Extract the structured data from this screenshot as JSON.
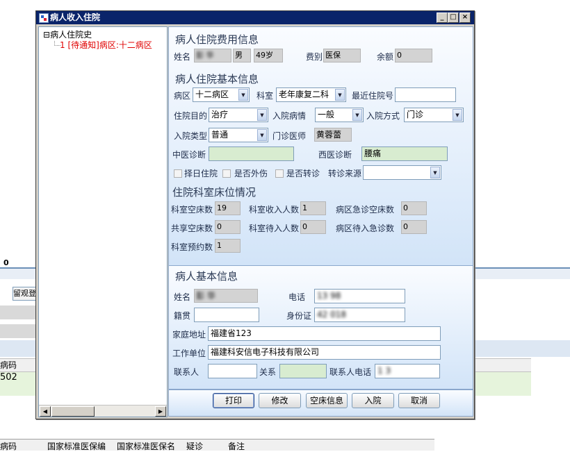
{
  "background": {
    "zero_label": "0",
    "button_label": "留观登",
    "table_header": "病码",
    "table_cell": "502",
    "footer_columns": [
      "病码",
      "国家标准医保编",
      "国家标准医保名",
      "疑诊",
      "备注"
    ]
  },
  "dialog": {
    "title": "病人收入住院",
    "window_buttons": {
      "minimize": "_",
      "maximize": "□",
      "close": "×"
    },
    "tree": {
      "root": "病人住院史",
      "child": "1 [待通知]病区:十二病区"
    },
    "fee_section": {
      "title": "病人住院费用信息",
      "name_label": "姓名",
      "name_value": "彭  华",
      "gender_value": "男",
      "age_value": "49岁",
      "fee_type_label": "费别",
      "fee_type_value": "医保",
      "balance_label": "余额",
      "balance_value": "0"
    },
    "basic_section": {
      "title": "病人住院基本信息",
      "ward_label": "病区",
      "ward_value": "十二病区",
      "dept_label": "科室",
      "dept_value": "老年康复二科",
      "recent_no_label": "最近住院号",
      "recent_no_value": "",
      "purpose_label": "住院目的",
      "purpose_value": "治疗",
      "condition_label": "入院病情",
      "condition_value": "一般",
      "method_label": "入院方式",
      "method_value": "门诊",
      "type_label": "入院类型",
      "type_value": "普通",
      "doctor_label": "门诊医师",
      "doctor_value": "黄蓉蕾",
      "tcm_label": "中医诊断",
      "tcm_value": "",
      "wm_label": "西医诊断",
      "wm_value": "腰痛",
      "check_select_date": "择日住院",
      "check_trauma": "是否外伤",
      "check_transfer": "是否转诊",
      "transfer_source_label": "转诊来源",
      "transfer_source_value": ""
    },
    "bed_section": {
      "title": "住院科室床位情况",
      "dept_empty_label": "科室空床数",
      "dept_empty_value": "19",
      "dept_admit_label": "科室收入人数",
      "dept_admit_value": "1",
      "ward_emerg_label": "病区急诊空床数",
      "ward_emerg_value": "0",
      "shared_empty_label": "共享空床数",
      "shared_empty_value": "0",
      "dept_wait_label": "科室待入人数",
      "dept_wait_value": "0",
      "ward_wait_label": "病区待入急诊数",
      "ward_wait_value": "0",
      "dept_reserve_label": "科室预约数",
      "dept_reserve_value": "1"
    },
    "patient_section": {
      "title": "病人基本信息",
      "name_label": "姓名",
      "name_value": "彭  华",
      "phone_label": "电话",
      "phone_value": "13       98",
      "native_label": "籍贯",
      "native_value": "",
      "id_label": "身份证",
      "id_value": "42         018",
      "address_label": "家庭地址",
      "address_value": "福建省123",
      "work_label": "工作单位",
      "work_value": "福建科安信电子科技有限公司",
      "contact_label": "联系人",
      "contact_value": "",
      "relation_label": "关系",
      "relation_value": "",
      "contact_phone_label": "联系人电话",
      "contact_phone_value": "1       3"
    },
    "buttons": {
      "print": "打印",
      "modify": "修改",
      "empty_bed": "空床信息",
      "admit": "入院",
      "cancel": "取消"
    }
  }
}
